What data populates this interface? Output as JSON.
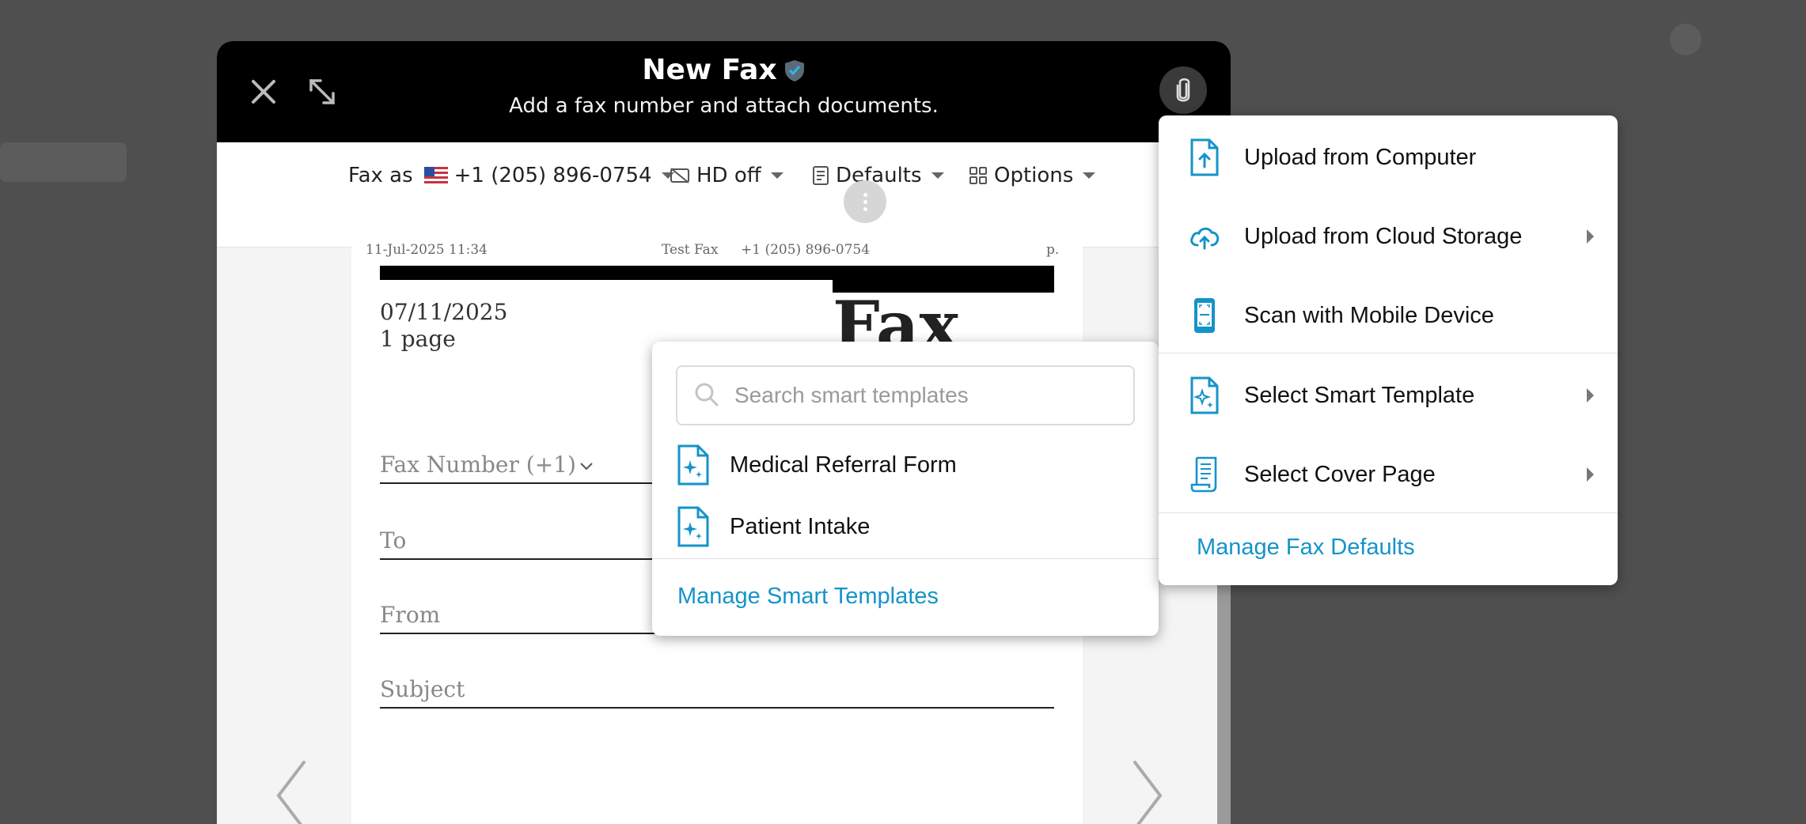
{
  "modal": {
    "title": "New Fax",
    "subtitle": "Add a fax number and attach documents."
  },
  "toolbar": {
    "fax_as_label": "Fax as",
    "fax_number": "+1 (205) 896-0754",
    "hd_label": "HD off",
    "defaults_label": "Defaults",
    "options_label": "Options"
  },
  "page": {
    "header_date": "11-Jul-2025 11:34",
    "header_sender": "Test Fax",
    "header_number": "+1 (205) 896-0754",
    "header_page": "p.",
    "big_title": "Fax",
    "date": "07/11/2025",
    "pages": "1 page",
    "fax_number_label": "Fax Number (+1)",
    "to_label": "To",
    "from_label": "From",
    "subject_label": "Subject"
  },
  "smart_templates": {
    "search_placeholder": "Search smart templates",
    "items": [
      {
        "label": "Medical Referral Form"
      },
      {
        "label": "Patient Intake"
      }
    ],
    "manage_label": "Manage Smart Templates"
  },
  "attach_menu": {
    "items": [
      {
        "label": "Upload from Computer",
        "icon": "upload-file-icon"
      },
      {
        "label": "Upload from Cloud Storage",
        "icon": "cloud-upload-icon"
      },
      {
        "label": "Scan with Mobile Device",
        "icon": "mobile-scan-icon"
      },
      {
        "label": "Select Smart Template",
        "icon": "smart-template-icon"
      },
      {
        "label": "Select Cover Page",
        "icon": "cover-page-icon"
      }
    ],
    "manage_label": "Manage Fax Defaults"
  },
  "colors": {
    "accent": "#1593c9",
    "header_bg": "#000000",
    "overlay": "#4f4f4f"
  }
}
